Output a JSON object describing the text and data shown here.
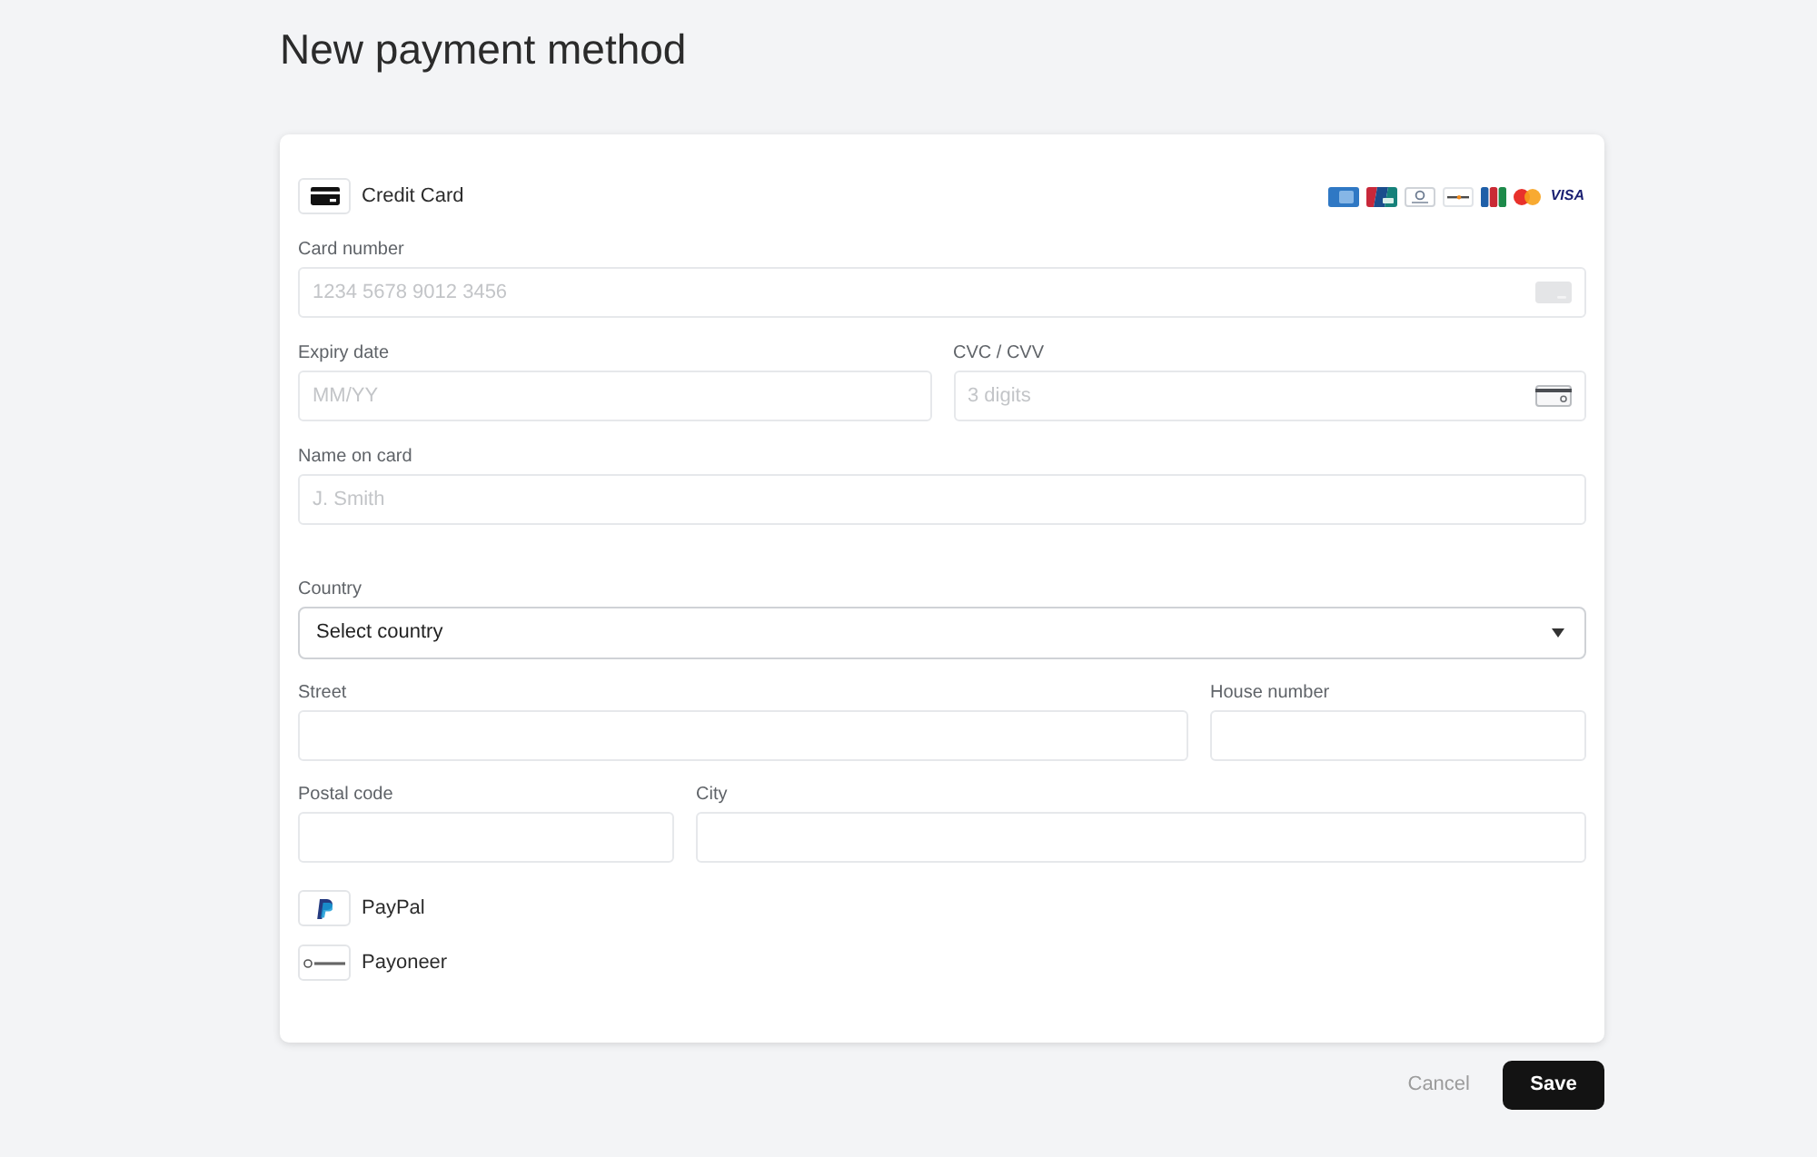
{
  "page": {
    "title": "New payment method"
  },
  "payment_methods": [
    {
      "kind": "card",
      "label": "Credit Card",
      "card_brands": [
        {
          "kind": "blue"
        },
        {
          "kind": "tricolor"
        },
        {
          "kind": "outline"
        },
        {
          "kind": "strip"
        },
        {
          "kind": "bars"
        },
        {
          "kind": "circles"
        },
        {
          "kind": "word",
          "text": "VISA"
        }
      ],
      "card_details": {
        "card_number": {
          "label": "Card number",
          "placeholder": "1234 5678 9012 3456"
        },
        "expiry_date": {
          "label": "Expiry date",
          "placeholder": "MM/YY"
        },
        "cvc": {
          "label": "CVC / CVV",
          "placeholder": "3 digits"
        },
        "name_on_card": {
          "label": "Name on card",
          "placeholder": "J. Smith"
        }
      },
      "billing_address": {
        "country": {
          "label": "Country",
          "value": "Select country"
        },
        "street": {
          "label": "Street"
        },
        "house_number": {
          "label": "House number"
        },
        "postal_code": {
          "label": "Postal code"
        },
        "city": {
          "label": "City"
        }
      }
    },
    {
      "kind": "paypal",
      "label": "PayPal"
    },
    {
      "kind": "payoneer",
      "label": "Payoneer"
    }
  ],
  "actions": {
    "cancel": "Cancel",
    "save": "Save"
  }
}
